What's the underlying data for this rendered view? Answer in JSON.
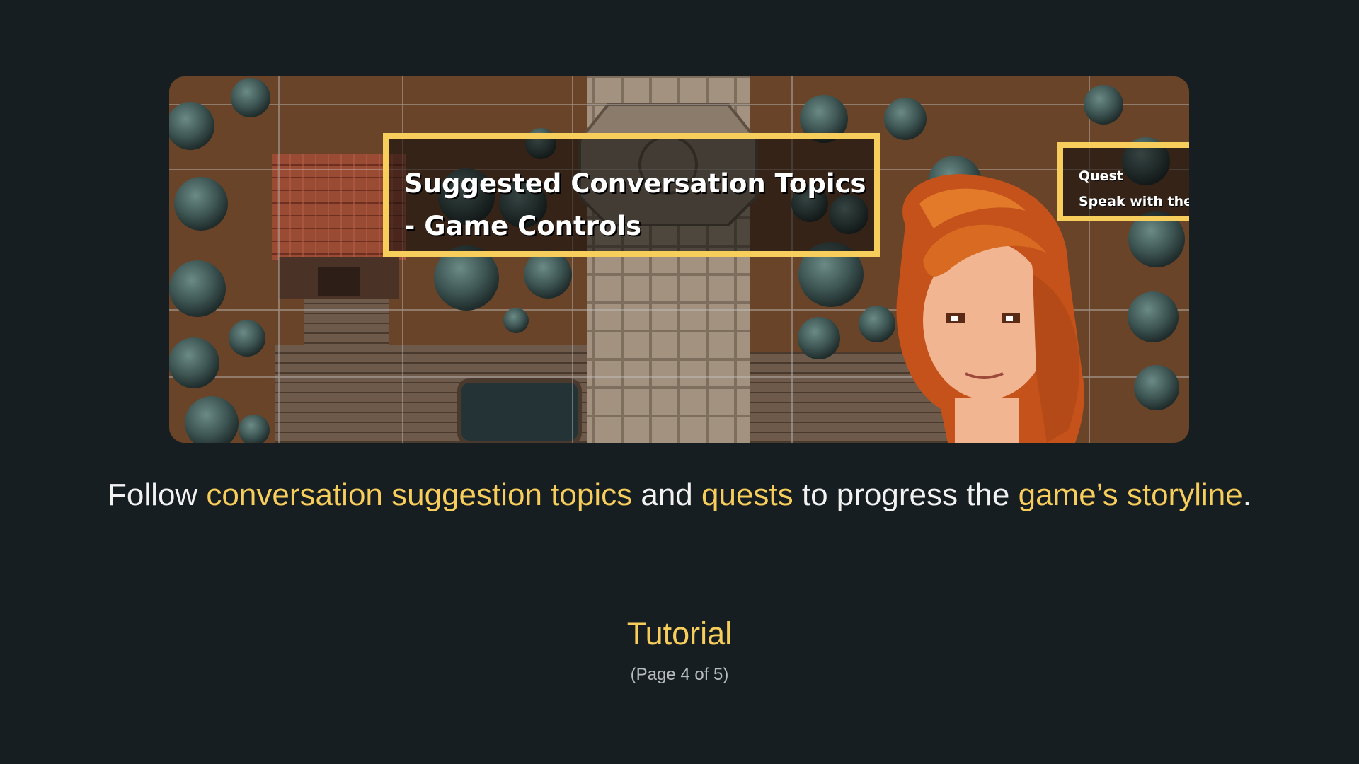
{
  "screen": {
    "background_color": "#171e21",
    "accent_color": "#f7cd5c"
  },
  "game_view": {
    "scene": "pixel-art top-down village map with character portrait",
    "topics_panel": {
      "line1": "Suggested Conversation Topics",
      "line2": "- Game Controls"
    },
    "quest_panel": {
      "title": "Quest",
      "task": "Speak with the mysterious lady"
    }
  },
  "caption": {
    "part1": "Follow ",
    "highlight1": "conversation suggestion topics",
    "part2": " and ",
    "highlight2": "quests",
    "part3": " to progress the ",
    "highlight3": "game’s storyline",
    "part4": "."
  },
  "footer": {
    "title": "Tutorial",
    "page_indicator": "(Page 4 of 5)"
  }
}
